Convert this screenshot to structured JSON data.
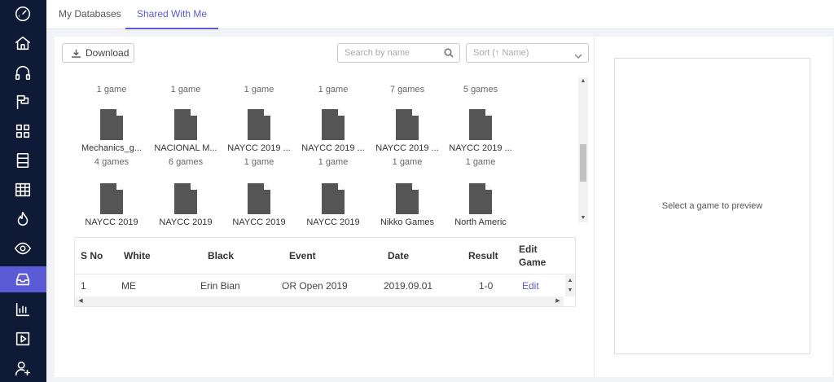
{
  "tabs": [
    {
      "label": "My Databases",
      "active": false
    },
    {
      "label": "Shared With Me",
      "active": true
    }
  ],
  "sidebar": {
    "items": [
      {
        "icon": "speedometer-icon"
      },
      {
        "icon": "home-icon"
      },
      {
        "icon": "headphones-icon"
      },
      {
        "icon": "flag-icon"
      },
      {
        "icon": "grid-icon"
      },
      {
        "icon": "server-icon"
      },
      {
        "icon": "table-icon"
      },
      {
        "icon": "flame-icon"
      },
      {
        "icon": "eye-icon"
      },
      {
        "icon": "inbox-icon",
        "active": true
      },
      {
        "icon": "bar-chart-icon"
      },
      {
        "icon": "play-icon"
      },
      {
        "icon": "user-plus-icon"
      }
    ],
    "active_color": "#5b5bd6",
    "background": "#0e1a36"
  },
  "toolbar": {
    "download_label": "Download",
    "search_placeholder": "Search by name",
    "sort_label": "Sort (↑ Name)"
  },
  "grid": {
    "top_counts": [
      "1 game",
      "1 game",
      "1 game",
      "1 game",
      "7 games",
      "5 games"
    ],
    "row1": [
      {
        "name": "Mechanics_g...",
        "count": "4 games"
      },
      {
        "name": "NACIONAL M...",
        "count": "6 games"
      },
      {
        "name": "NAYCC 2019 ...",
        "count": "1 game"
      },
      {
        "name": "NAYCC 2019 ...",
        "count": "1 game"
      },
      {
        "name": "NAYCC 2019 ...",
        "count": "1 game"
      },
      {
        "name": "NAYCC 2019 ...",
        "count": "1 game"
      }
    ],
    "row2": [
      {
        "name": "NAYCC 2019"
      },
      {
        "name": "NAYCC 2019"
      },
      {
        "name": "NAYCC 2019"
      },
      {
        "name": "NAYCC 2019"
      },
      {
        "name": "Nikko Games"
      },
      {
        "name": "North Americ"
      }
    ]
  },
  "table": {
    "headers": {
      "sno": "S No",
      "white": "White",
      "black": "Black",
      "event": "Event",
      "date": "Date",
      "result": "Result",
      "edit1": "Edit",
      "edit2": "Game"
    },
    "rows": [
      {
        "sno": "1",
        "white": "ME",
        "black": "Erin Bian",
        "event": "OR Open 2019",
        "date": "2019.09.01",
        "result": "1-0",
        "edit": "Edit"
      }
    ]
  },
  "preview": {
    "placeholder": "Select a game to preview"
  }
}
